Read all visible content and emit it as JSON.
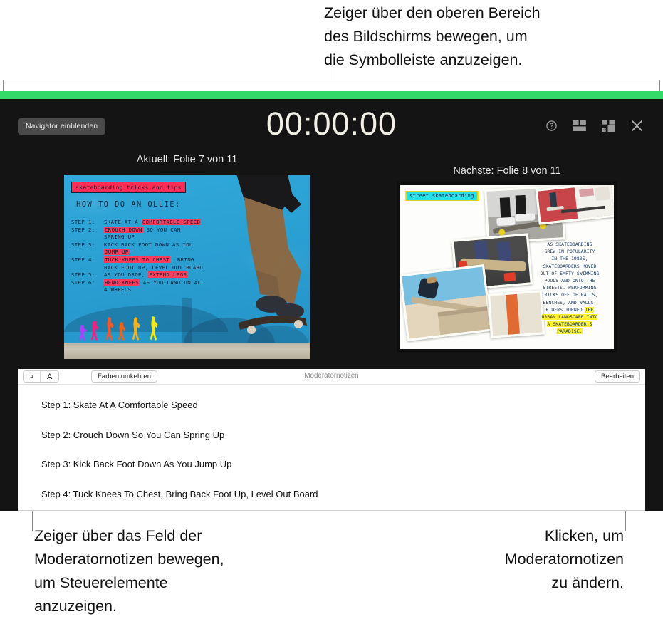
{
  "callouts": {
    "top": "Zeiger über den oberen Bereich\ndes Bildschirms bewegen, um\ndie Symbolleiste anzuzeigen.",
    "bottom_left": "Zeiger über das Feld der\nModeratornotizen bewegen,\num Steuerelemente\nanzuzeigen.",
    "bottom_right": "Klicken, um\nModeratornotizen\nzu ändern."
  },
  "toolbar": {
    "navigator_button": "Navigator einblenden",
    "timer": "00:00:00",
    "icons": [
      {
        "name": "help-icon",
        "title": "Hilfe"
      },
      {
        "name": "layout-icon",
        "title": "Layout"
      },
      {
        "name": "swap-displays-icon",
        "title": "Anzeigen tauschen"
      },
      {
        "name": "close-icon",
        "title": "Schließen"
      }
    ]
  },
  "slides": {
    "current_label": "Aktuell: Folie 7 von 11",
    "next_label": "Nächste: Folie 8 von 11",
    "current": {
      "tag": "skateboarding tricks and tips",
      "heading": "HOW TO DO AN OLLIE:",
      "steps": [
        {
          "num": "STEP 1:",
          "parts": [
            {
              "t": "SKATE AT A ",
              "hl": false
            },
            {
              "t": "COMFORTABLE SPEED",
              "hl": true
            }
          ]
        },
        {
          "num": "STEP 2:",
          "parts": [
            {
              "t": "CROUCH DOWN",
              "hl": true
            },
            {
              "t": " SO YOU CAN",
              "hl": false
            }
          ]
        },
        {
          "num": "",
          "parts": [
            {
              "t": "SPRING UP",
              "hl": false
            }
          ]
        },
        {
          "num": "STEP 3:",
          "parts": [
            {
              "t": "KICK BACK FOOT DOWN AS YOU",
              "hl": false
            }
          ]
        },
        {
          "num": "",
          "parts": [
            {
              "t": "JUMP UP",
              "hl": true
            }
          ]
        },
        {
          "num": "STEP 4:",
          "parts": [
            {
              "t": "TUCK KNEES TO CHEST",
              "hl": true
            },
            {
              "t": ", BRING",
              "hl": false
            }
          ]
        },
        {
          "num": "",
          "parts": [
            {
              "t": "BACK FOOT UP, LEVEL OUT BOARD",
              "hl": false
            }
          ]
        },
        {
          "num": "STEP 5:",
          "parts": [
            {
              "t": "AS YOU DROP, ",
              "hl": false
            },
            {
              "t": "EXTEND LEGS",
              "hl": true
            }
          ]
        },
        {
          "num": "STEP 6:",
          "parts": [
            {
              "t": "BEND KNEES",
              "hl": true
            },
            {
              "t": " AS YOU LAND ON ALL",
              "hl": false
            }
          ]
        },
        {
          "num": "",
          "parts": [
            {
              "t": "4 WHEELS",
              "hl": false
            }
          ]
        }
      ]
    },
    "next": {
      "tag": "street skateboarding",
      "body": [
        {
          "t": "AS SKATEBOARDING",
          "hl": false
        },
        {
          "t": "GREW IN POPULARITY",
          "hl": false
        },
        {
          "t": "IN THE 1980S,",
          "hl": false
        },
        {
          "t": "SKATEBOARDERS MOVED",
          "hl": false
        },
        {
          "t": "OUT OF EMPTY SWIMMING",
          "hl": false
        },
        {
          "t": "POOLS AND ONTO THE",
          "hl": false
        },
        {
          "t": "STREETS. PERFORMING",
          "hl": false
        },
        {
          "t": "TRICKS OFF OF RAILS,",
          "hl": false
        },
        {
          "t": "BENCHES, AND WALLS,",
          "hl": false
        },
        {
          "t": "RIDERS TURNED THE",
          "hl": "partial-end"
        },
        {
          "t": "URBAN LANDSCAPE INTO",
          "hl": true
        },
        {
          "t": "A SKATEBOARDER'S",
          "hl": true
        },
        {
          "t": "PARADISE.",
          "hl": true
        }
      ]
    }
  },
  "notes": {
    "panel_title": "Moderatornotizen",
    "font_small_label": "A",
    "font_large_label": "A",
    "invert_colors_button": "Farben umkehren",
    "edit_button": "Bearbeiten",
    "lines": [
      "Step 1: Skate At A Comfortable Speed",
      "Step 2: Crouch Down So You Can Spring Up",
      "Step 3: Kick Back Foot Down As You Jump Up",
      "Step 4: Tuck Knees To Chest, Bring Back Foot Up, Level Out Board"
    ]
  },
  "colors": {
    "accent_green": "#33da68",
    "display_bg": "#141414",
    "highlight_red": "#ff3b5c",
    "highlight_yellow": "#fff22d",
    "slide_blue": "#2fa8d8"
  }
}
